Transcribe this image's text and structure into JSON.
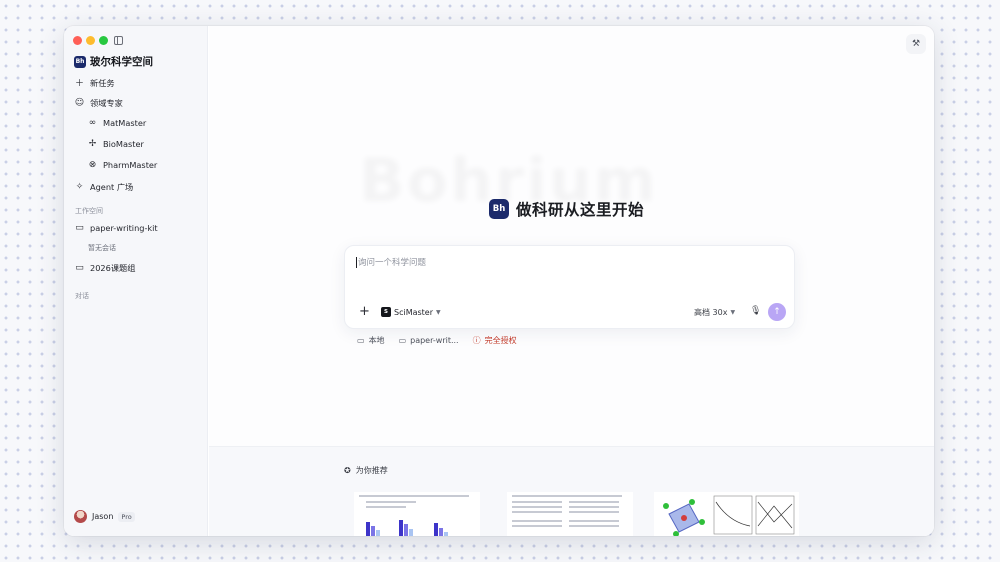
{
  "window": {
    "brand_logo": "Bh",
    "brand_name": "玻尔科学空间"
  },
  "sidebar": {
    "new_task": "新任务",
    "domain_experts": "领域专家",
    "experts": [
      {
        "label": "MatMaster",
        "icon": "glasses-icon"
      },
      {
        "label": "BioMaster",
        "icon": "dna-icon"
      },
      {
        "label": "PharmMaster",
        "icon": "pill-icon"
      }
    ],
    "agent_plaza": "Agent 广场",
    "workspace_label": "工作空间",
    "folders": [
      {
        "label": "paper-writing-kit",
        "sub": "暂无会话"
      },
      {
        "label": "2026课题组"
      }
    ],
    "conversations_label": "对话",
    "user": {
      "name": "Jason",
      "badge": "Pro"
    }
  },
  "main": {
    "ghost_text": "Bohrium",
    "headline_logo": "Bh",
    "headline": "做科研从这里开始",
    "composer": {
      "placeholder": "询问一个科学问题",
      "model_logo": "S",
      "model": "SciMaster",
      "quota": "高档 30x"
    },
    "chips": {
      "local": "本地",
      "folder": "paper-writ...",
      "permission": "完全授权"
    },
    "recommend_title": "为你推荐"
  },
  "colors": {
    "accent_send": "#b9a6f5",
    "brand_navy": "#1b2a6b",
    "warning_red": "#c23b2b"
  }
}
